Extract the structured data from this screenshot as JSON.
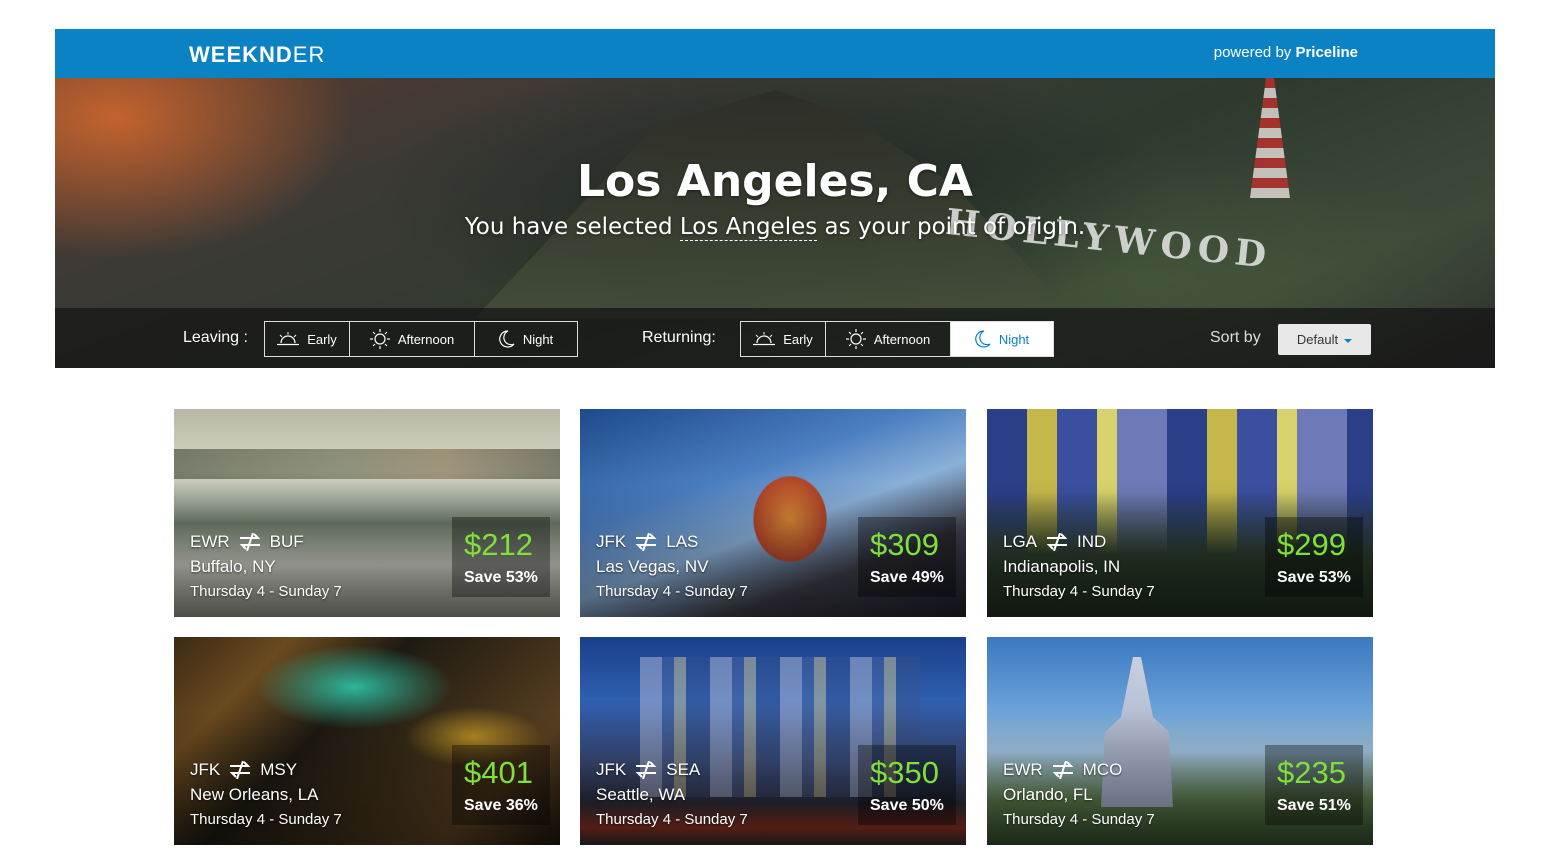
{
  "brand": {
    "bold": "WEEKND",
    "light": "ER"
  },
  "powered": {
    "prefix": "powered by ",
    "name": "Priceline"
  },
  "hero": {
    "title": "Los Angeles, CA",
    "subtitle_pre": "You have selected ",
    "subtitle_link": "Los Angeles",
    "subtitle_post": " as your point of origin.",
    "sign_text": "HOLLYWOOD"
  },
  "filters": {
    "leaving_label": "Leaving :",
    "returning_label": "Returning:",
    "leaving_options": [
      {
        "label": "Early",
        "icon": "sunrise-icon",
        "active": false
      },
      {
        "label": "Afternoon",
        "icon": "sun-icon",
        "active": false
      },
      {
        "label": "Night",
        "icon": "moon-icon",
        "active": false
      }
    ],
    "returning_options": [
      {
        "label": "Early",
        "icon": "sunrise-icon",
        "active": false
      },
      {
        "label": "Afternoon",
        "icon": "sun-icon",
        "active": false
      },
      {
        "label": "Night",
        "icon": "moon-icon",
        "active": true
      }
    ],
    "sort_label": "Sort by",
    "sort_value": "Default"
  },
  "colors": {
    "brand_blue": "#0a82c4",
    "price_green": "#7fe03a"
  },
  "deals": [
    {
      "from": "EWR",
      "to": "BUF",
      "city": "Buffalo, NY",
      "dates": "Thursday 4 - Sunday 7",
      "price": "$212",
      "save": "Save 53%"
    },
    {
      "from": "JFK",
      "to": "LAS",
      "city": "Las Vegas, NV",
      "dates": "Thursday 4 - Sunday 7",
      "price": "$309",
      "save": "Save 49%"
    },
    {
      "from": "LGA",
      "to": "IND",
      "city": "Indianapolis, IN",
      "dates": "Thursday 4 - Sunday 7",
      "price": "$299",
      "save": "Save 53%"
    },
    {
      "from": "JFK",
      "to": "MSY",
      "city": "New Orleans, LA",
      "dates": "Thursday 4 - Sunday 7",
      "price": "$401",
      "save": "Save 36%"
    },
    {
      "from": "JFK",
      "to": "SEA",
      "city": "Seattle, WA",
      "dates": "Thursday 4 - Sunday 7",
      "price": "$350",
      "save": "Save 50%"
    },
    {
      "from": "EWR",
      "to": "MCO",
      "city": "Orlando, FL",
      "dates": "Thursday 4 - Sunday 7",
      "price": "$235",
      "save": "Save 51%"
    }
  ]
}
